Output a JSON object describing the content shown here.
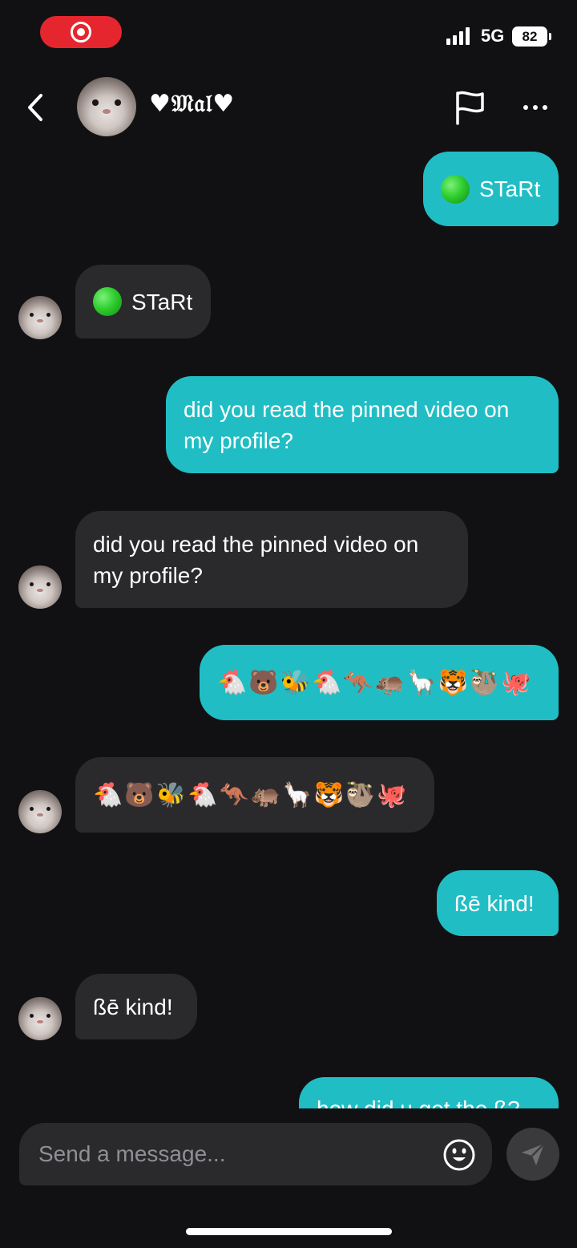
{
  "status_bar": {
    "network": "5G",
    "battery": "82"
  },
  "header": {
    "contact_name": "♥𝔐𝔞𝔩♥",
    "back_icon": "chevron-left-icon",
    "report_icon": "flag-icon",
    "more_icon": "more-horizontal-icon"
  },
  "messages": [
    {
      "direction": "sent",
      "text": "STaRt",
      "has_green_dot": true
    },
    {
      "direction": "received",
      "text": "STaRt",
      "has_green_dot": true
    },
    {
      "direction": "sent",
      "text": "did you read the pinned video on\nmy profile?"
    },
    {
      "direction": "received",
      "text": "did you read the pinned video on\nmy profile?"
    },
    {
      "direction": "sent",
      "text": "🐔🐻🐝🐔🦘🦛🦙🐯🦥🐙"
    },
    {
      "direction": "received",
      "text": "🐔🐻🐝🐔🦘🦛🦙🐯🦥🐙"
    },
    {
      "direction": "sent",
      "text": "ßē kind!"
    },
    {
      "direction": "received",
      "text": "ßē kind!"
    },
    {
      "direction": "sent",
      "text": "how did u get the ß?",
      "partially_visible": true
    }
  ],
  "composer": {
    "placeholder": "Send a message...",
    "emoji_icon": "smiley-face-icon",
    "send_icon": "send-icon"
  },
  "colors": {
    "sent_bubble": "#20bec4",
    "received_bubble": "#2a2a2d",
    "background": "#111113",
    "record_pill": "#e5262e"
  }
}
